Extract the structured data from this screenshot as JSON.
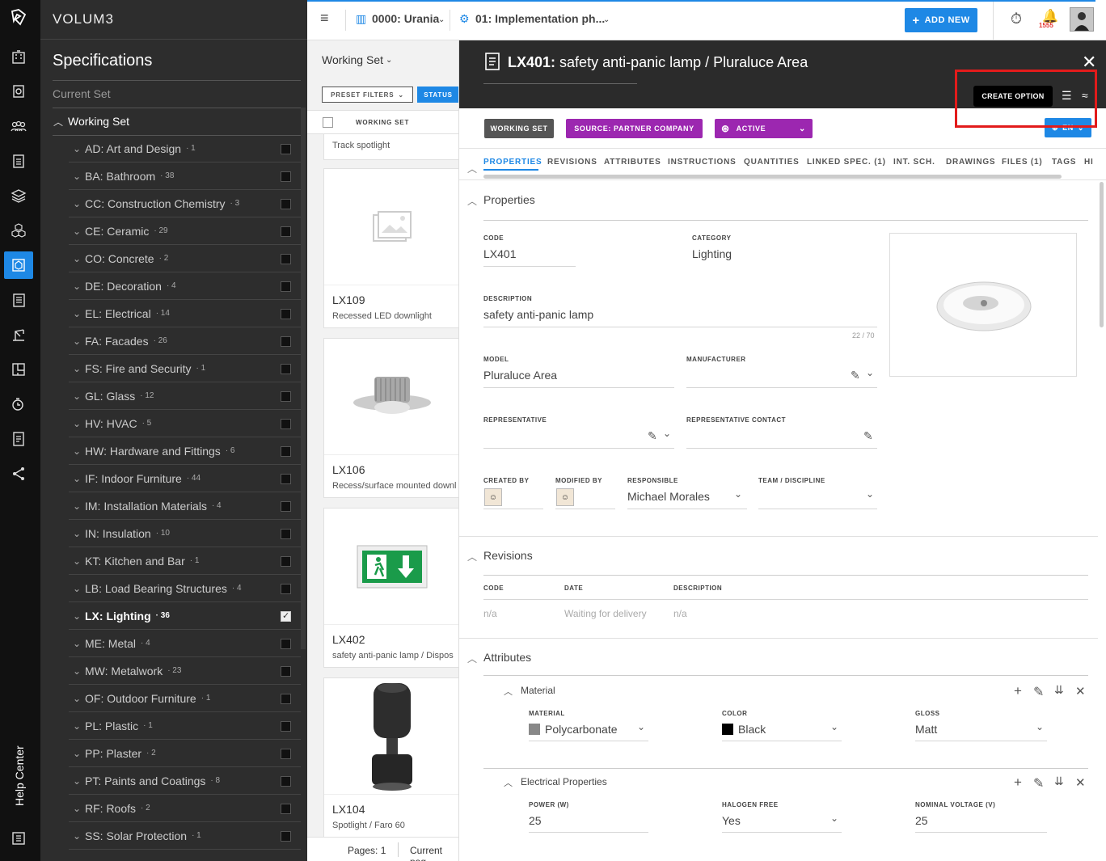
{
  "brand": "VOLUM3",
  "help_center": "Help Center",
  "sidebar": {
    "title": "Specifications",
    "current_set": "Current Set",
    "working_set": "Working Set",
    "categories": [
      {
        "label": "AD: Art and Design",
        "count": "· 1"
      },
      {
        "label": "BA: Bathroom",
        "count": "· 38"
      },
      {
        "label": "CC: Construction Chemistry",
        "count": "· 3"
      },
      {
        "label": "CE: Ceramic",
        "count": "· 29"
      },
      {
        "label": "CO: Concrete",
        "count": "· 2"
      },
      {
        "label": "DE: Decoration",
        "count": "· 4"
      },
      {
        "label": "EL: Electrical",
        "count": "· 14"
      },
      {
        "label": "FA: Facades",
        "count": "· 26"
      },
      {
        "label": "FS: Fire and Security",
        "count": "· 1"
      },
      {
        "label": "GL: Glass",
        "count": "· 12"
      },
      {
        "label": "HV: HVAC",
        "count": "· 5"
      },
      {
        "label": "HW: Hardware and Fittings",
        "count": "· 6"
      },
      {
        "label": "IF: Indoor Furniture",
        "count": "· 44"
      },
      {
        "label": "IM: Installation Materials",
        "count": "· 4"
      },
      {
        "label": "IN: Insulation",
        "count": "· 10"
      },
      {
        "label": "KT: Kitchen and Bar",
        "count": "· 1"
      },
      {
        "label": "LB: Load Bearing Structures",
        "count": "· 4"
      },
      {
        "label": "LX: Lighting",
        "count": "· 36",
        "selected": true
      },
      {
        "label": "ME: Metal",
        "count": "· 4"
      },
      {
        "label": "MW: Metalwork",
        "count": "· 23"
      },
      {
        "label": "OF: Outdoor Furniture",
        "count": "· 1"
      },
      {
        "label": "PL: Plastic",
        "count": "· 1"
      },
      {
        "label": "PP: Plaster",
        "count": "· 2"
      },
      {
        "label": "PT: Paints and Coatings",
        "count": "· 8"
      },
      {
        "label": "RF: Roofs",
        "count": "· 2"
      },
      {
        "label": "SS: Solar Protection",
        "count": "· 1"
      }
    ]
  },
  "topbar": {
    "project": "0000: Urania",
    "phase": "01: Implementation ph...",
    "add_new": "ADD NEW",
    "notifications": "1555"
  },
  "list": {
    "set_label": "Working Set",
    "preset_filters": "PRESET FILTERS",
    "status": "STATUS",
    "column_header": "WORKING SET",
    "first_row": "Track spotlight",
    "cards": [
      {
        "code": "LX109",
        "name": "Recessed LED downlight"
      },
      {
        "code": "LX106",
        "name": "Recess/surface mounted downl"
      },
      {
        "code": "LX402",
        "name": "safety anti-panic lamp / Dispos"
      },
      {
        "code": "LX104",
        "name": "Spotlight / Faro 60"
      }
    ],
    "pages": "Pages: 1",
    "current_page": "Current pag"
  },
  "detail": {
    "code": "LX401:",
    "title": "safety anti-panic lamp / Pluraluce Area",
    "tooltip": "CREATE OPTION",
    "chips": {
      "working_set": "WORKING SET",
      "source": "SOURCE: PARTNER COMPANY",
      "status": "ACTIVE",
      "lang": "EN"
    },
    "tabs": [
      "PROPERTIES",
      "REVISIONS",
      "ATTRIBUTES",
      "INSTRUCTIONS",
      "QUANTITIES",
      "LINKED SPEC. (1)",
      "INT. SCH.",
      "DRAWINGS",
      "FILES (1)",
      "TAGS",
      "HI"
    ],
    "properties": {
      "title": "Properties",
      "code_label": "CODE",
      "code": "LX401",
      "category_label": "CATEGORY",
      "category": "Lighting",
      "description_label": "DESCRIPTION",
      "description": "safety anti-panic lamp",
      "char_count": "22 / 70",
      "model_label": "MODEL",
      "model": "Pluraluce Area",
      "manufacturer_label": "MANUFACTURER",
      "representative_label": "REPRESENTATIVE",
      "rep_contact_label": "REPRESENTATIVE CONTACT",
      "created_by_label": "CREATED BY",
      "modified_by_label": "MODIFIED BY",
      "responsible_label": "RESPONSIBLE",
      "responsible": "Michael Morales",
      "team_label": "TEAM / DISCIPLINE"
    },
    "revisions": {
      "title": "Revisions",
      "headers": [
        "CODE",
        "DATE",
        "DESCRIPTION"
      ],
      "row": [
        "n/a",
        "Waiting for delivery",
        "n/a"
      ]
    },
    "attributes": {
      "title": "Attributes",
      "material": {
        "title": "Material",
        "material_label": "MATERIAL",
        "material": "Polycarbonate",
        "color_label": "COLOR",
        "color": "Black",
        "color_hex": "#000000",
        "material_swatch": "#888888",
        "gloss_label": "GLOSS",
        "gloss": "Matt"
      },
      "electrical": {
        "title": "Electrical Properties",
        "power_label": "POWER (W)",
        "power": "25",
        "halogen_label": "HALOGEN FREE",
        "halogen": "Yes",
        "voltage_label": "NOMINAL VOLTAGE (V)",
        "voltage": "25"
      }
    }
  }
}
